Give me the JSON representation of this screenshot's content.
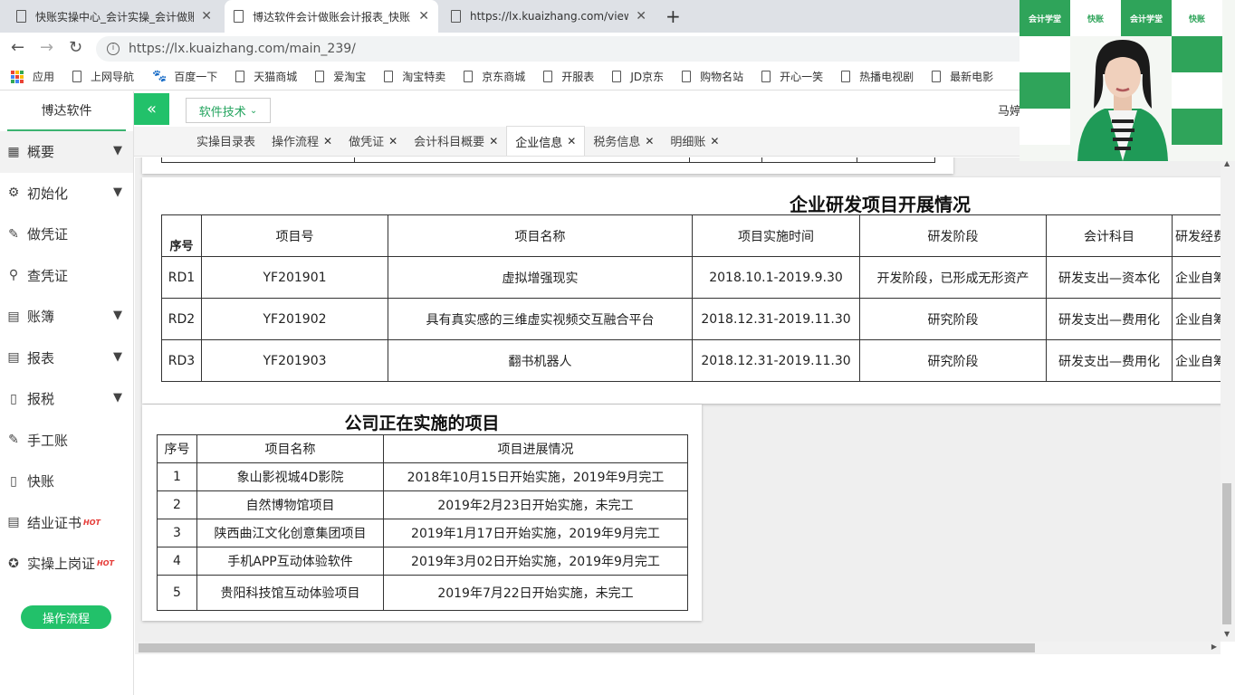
{
  "browser": {
    "tabs": [
      {
        "title": "快账实操中心_会计实操_会计做账"
      },
      {
        "title": "博达软件会计做账会计报表_快账"
      },
      {
        "title": "https://lx.kuaizhang.com/view/"
      }
    ],
    "new_tab": "+",
    "url": "https://lx.kuaizhang.com/main_239/",
    "bookmarks": [
      "应用",
      "上网导航",
      "百度一下",
      "天猫商城",
      "爱淘宝",
      "淘宝特卖",
      "京东商城",
      "开服表",
      "JD京东",
      "购物名站",
      "开心一笑",
      "热播电视剧",
      "最新电影"
    ]
  },
  "sidebar": {
    "brand": "博达软件",
    "items": [
      {
        "label": "概要",
        "icon": "grid-icon",
        "expandable": true
      },
      {
        "label": "初始化",
        "icon": "gear-icon",
        "expandable": true
      },
      {
        "label": "做凭证",
        "icon": "pen-icon",
        "expandable": false
      },
      {
        "label": "查凭证",
        "icon": "search-icon",
        "expandable": false
      },
      {
        "label": "账簿",
        "icon": "book-icon",
        "expandable": true
      },
      {
        "label": "报表",
        "icon": "report-icon",
        "expandable": true
      },
      {
        "label": "报税",
        "icon": "document-icon",
        "expandable": true
      },
      {
        "label": "手工账",
        "icon": "pen-icon",
        "expandable": false
      },
      {
        "label": "快账",
        "icon": "document-icon",
        "expandable": false
      },
      {
        "label": "结业证书",
        "icon": "certificate-icon",
        "expandable": false,
        "badge": "HOT"
      },
      {
        "label": "实操上岗证",
        "icon": "badge-icon",
        "expandable": false,
        "badge": "HOT"
      }
    ],
    "flow_button": "操作流程"
  },
  "header": {
    "collapse": "«",
    "tech_dropdown": "软件技术",
    "user_name": "马婷"
  },
  "page_tabs": [
    {
      "label": "实操目录表",
      "closable": false,
      "active": false
    },
    {
      "label": "操作流程",
      "closable": true,
      "active": false
    },
    {
      "label": "做凭证",
      "closable": true,
      "active": false
    },
    {
      "label": "会计科目概要",
      "closable": true,
      "active": false
    },
    {
      "label": "企业信息",
      "closable": true,
      "active": true
    },
    {
      "label": "税务信息",
      "closable": true,
      "active": false
    },
    {
      "label": "明细账",
      "closable": true,
      "active": false
    }
  ],
  "rd_section": {
    "title": "企业研发项目开展情况",
    "headers": [
      "序号",
      "项目号",
      "项目名称",
      "项目实施时间",
      "研发阶段",
      "会计科目",
      "研发经费"
    ],
    "rows": [
      [
        "RD1",
        "YF201901",
        "虚拟增强现实",
        "2018.10.1-2019.9.30",
        "开发阶段，已形成无形资产",
        "研发支出—资本化",
        "企业自筹"
      ],
      [
        "RD2",
        "YF201902",
        "具有真实感的三维虚实视频交互融合平台",
        "2018.12.31-2019.11.30",
        "研究阶段",
        "研发支出—费用化",
        "企业自筹"
      ],
      [
        "RD3",
        "YF201903",
        "翻书机器人",
        "2018.12.31-2019.11.30",
        "研究阶段",
        "研发支出—费用化",
        "企业自筹"
      ]
    ]
  },
  "projects_section": {
    "title": "公司正在实施的项目",
    "headers": [
      "序号",
      "项目名称",
      "项目进展情况"
    ],
    "rows": [
      [
        "1",
        "象山影视城4D影院",
        "2018年10月15日开始实施，2019年9月完工"
      ],
      [
        "2",
        "自然博物馆项目",
        "2019年2月23日开始实施，未完工"
      ],
      [
        "3",
        "陕西曲江文化创意集团项目",
        "2019年1月17日开始实施，2019年9月完工"
      ],
      [
        "4",
        "手机APP互动体验软件",
        "2019年3月02日开始实施，2019年9月完工"
      ],
      [
        "5",
        "贵阳科技馆互动体验项目",
        "2019年7月22日开始实施，未完工"
      ]
    ]
  },
  "webcam": {
    "logos": [
      "会计学堂",
      "快账",
      "会计学堂",
      "快账"
    ]
  },
  "colors": {
    "accent": "#22c16a",
    "hot": "#e53935"
  }
}
